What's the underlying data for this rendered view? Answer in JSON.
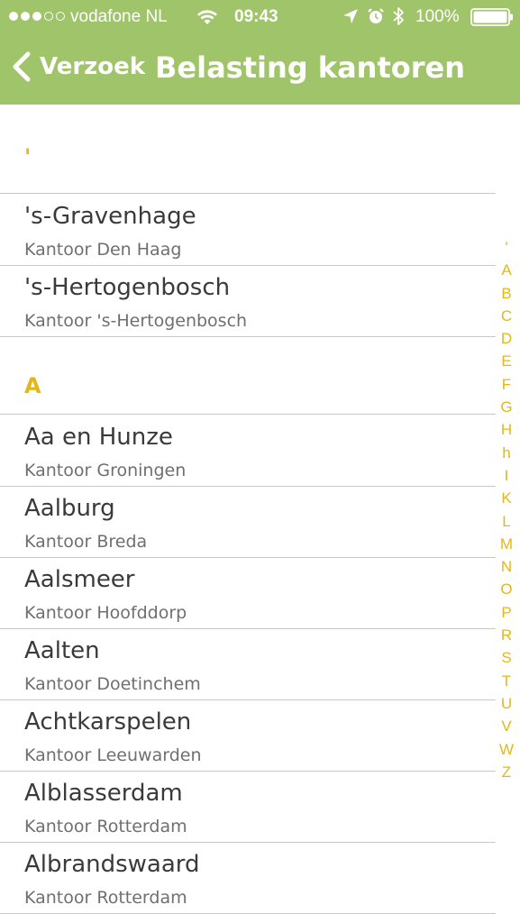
{
  "status_bar": {
    "carrier": "vodafone NL",
    "time": "09:43",
    "battery": "100%",
    "signal_bars_filled": 3,
    "signal_bars_total": 5,
    "battery_level": 1.0
  },
  "nav": {
    "back_label": "Verzoek",
    "title": "Belasting kantoren"
  },
  "sections": [
    {
      "letter": "'",
      "rows": [
        {
          "title": "'s-Gravenhage",
          "subtitle": "Kantoor Den Haag"
        },
        {
          "title": "'s-Hertogenbosch",
          "subtitle": "Kantoor 's-Hertogenbosch"
        }
      ]
    },
    {
      "letter": "A",
      "rows": [
        {
          "title": "Aa en Hunze",
          "subtitle": "Kantoor Groningen"
        },
        {
          "title": "Aalburg",
          "subtitle": "Kantoor Breda"
        },
        {
          "title": "Aalsmeer",
          "subtitle": "Kantoor Hoofddorp"
        },
        {
          "title": "Aalten",
          "subtitle": "Kantoor Doetinchem"
        },
        {
          "title": "Achtkarspelen",
          "subtitle": "Kantoor Leeuwarden"
        },
        {
          "title": "Alblasserdam",
          "subtitle": "Kantoor Rotterdam"
        },
        {
          "title": "Albrandswaard",
          "subtitle": "Kantoor Rotterdam"
        }
      ]
    }
  ],
  "index": [
    "'",
    "A",
    "B",
    "C",
    "D",
    "E",
    "F",
    "G",
    "H",
    "h",
    "I",
    "K",
    "L",
    "M",
    "N",
    "O",
    "P",
    "R",
    "S",
    "T",
    "U",
    "V",
    "W",
    "Z"
  ],
  "colors": {
    "header": "#a0c46a",
    "accent": "#e3b816",
    "title_text": "#3a3a3a",
    "subtitle_text": "#6f6f6f",
    "separator": "#c8c8c8"
  },
  "icons": {
    "back": "chevron-left-icon",
    "wifi": "wifi-icon",
    "location": "location-arrow-icon",
    "alarm": "alarm-clock-icon",
    "bluetooth": "bluetooth-icon",
    "battery": "battery-icon"
  }
}
